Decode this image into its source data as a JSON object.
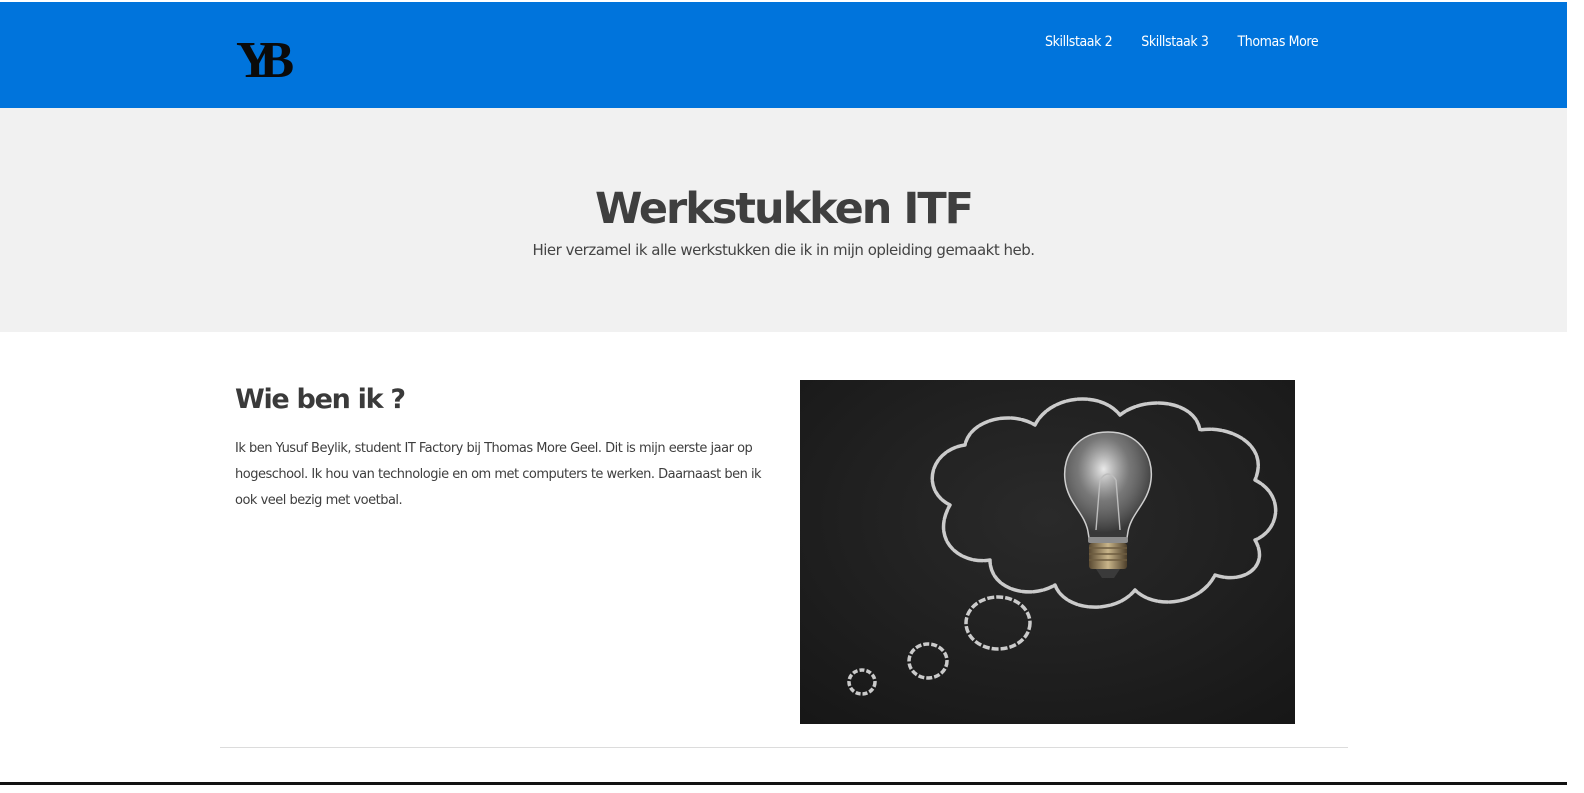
{
  "header": {
    "logo_text": "YB",
    "nav": [
      {
        "label": "Skillstaak 2"
      },
      {
        "label": "Skillstaak 3"
      },
      {
        "label": "Thomas More"
      }
    ]
  },
  "hero": {
    "title": "Werkstukken ITF",
    "subtitle": "Hier verzamel ik alle werkstukken die ik in mijn opleiding gemaakt heb."
  },
  "about": {
    "title": "Wie ben ik ?",
    "text": "Ik ben Yusuf Beylik, student IT Factory bij Thomas More Geel. Dit is mijn eerste jaar op hogeschool. Ik hou van technologie en om met computers te werken. Daarnaast ben ik ook veel bezig met voetbal."
  },
  "image": {
    "icon": "lightbulb-thought-cloud-icon"
  },
  "colors": {
    "header_bg": "#0074dc",
    "hero_bg": "#f1f1f1",
    "text_dark": "#3f3f3f",
    "chalkboard": "#1e1e1e"
  }
}
